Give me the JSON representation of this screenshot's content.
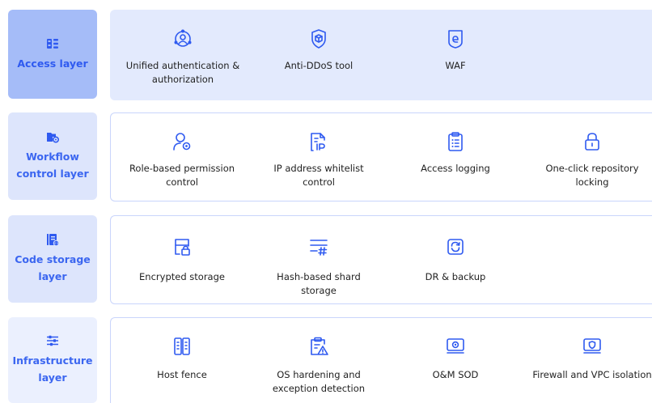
{
  "layers": [
    {
      "label": "Access layer",
      "icon": "layer-grid-icon",
      "items": [
        {
          "label": "Unified authentication & authorization",
          "icon": "users-network-icon"
        },
        {
          "label": "Anti-DDoS tool",
          "icon": "shield-cube-icon"
        },
        {
          "label": "WAF",
          "icon": "waf-badge-icon"
        }
      ]
    },
    {
      "label": "Workflow control layer",
      "icon": "folder-gear-icon",
      "items": [
        {
          "label": "Role-based permission control",
          "icon": "user-gear-icon"
        },
        {
          "label": "IP address whitelist control",
          "icon": "ip-document-icon"
        },
        {
          "label": "Access logging",
          "icon": "clipboard-list-icon"
        },
        {
          "label": "One-click repository locking",
          "icon": "lock-icon"
        }
      ]
    },
    {
      "label": "Code storage layer",
      "icon": "code-document-icon",
      "items": [
        {
          "label": "Encrypted storage",
          "icon": "storage-lock-icon"
        },
        {
          "label": "Hash-based shard storage",
          "icon": "hash-lines-icon"
        },
        {
          "label": "DR & backup",
          "icon": "backup-refresh-icon"
        }
      ]
    },
    {
      "label": "Infrastructure layer",
      "icon": "sliders-icon",
      "items": [
        {
          "label": "Host fence",
          "icon": "server-rack-icon"
        },
        {
          "label": "OS hardening and exception detection",
          "icon": "clipboard-warning-icon"
        },
        {
          "label": "O&M SOD",
          "icon": "monitor-gear-icon"
        },
        {
          "label": "Firewall and VPC isolation",
          "icon": "monitor-shield-icon"
        }
      ]
    }
  ],
  "colors": {
    "accent": "#3b66f0",
    "icon": "#2f5af0",
    "access_label_bg": "#a5bcf8",
    "access_panel_bg": "#e3eafd",
    "label_bg": "#dde5fc",
    "label_bg_light": "#ebf0fe",
    "panel_border": "#c9d5fb"
  }
}
